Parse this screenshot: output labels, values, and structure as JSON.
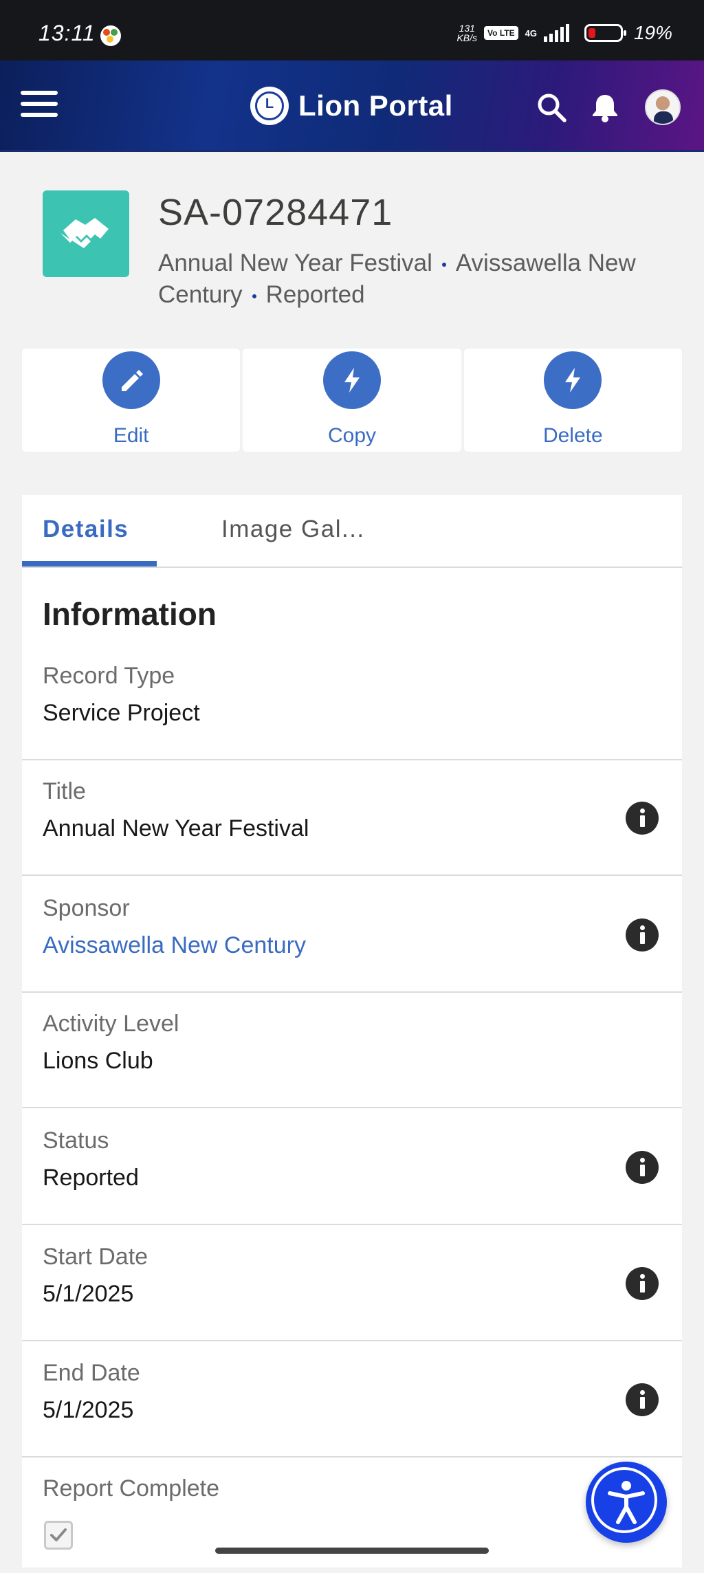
{
  "status_bar": {
    "time": "13:11",
    "net_speed_top": "131",
    "net_speed_bottom": "KB/s",
    "volte": "Vo LTE",
    "network": "4G",
    "battery": "19%"
  },
  "header": {
    "title": "Lion Portal",
    "menu_icon": "hamburger-menu-icon",
    "search_icon": "search-icon",
    "bell_icon": "notification-bell-icon",
    "avatar_icon": "user-avatar"
  },
  "record": {
    "id": "SA-07284471",
    "icon": "handshake-icon",
    "icon_color": "#3cc3b2",
    "subtitle": {
      "title": "Annual New Year Festival",
      "sponsor": "Avissawella New Century",
      "status": "Reported"
    }
  },
  "actions": [
    {
      "label": "Edit",
      "icon": "pencil-icon"
    },
    {
      "label": "Copy",
      "icon": "lightning-icon"
    },
    {
      "label": "Delete",
      "icon": "lightning-icon"
    }
  ],
  "tabs": [
    {
      "label": "Details",
      "active": true
    },
    {
      "label": "Image Gal..."
    }
  ],
  "section": {
    "title": "Information"
  },
  "fields": [
    {
      "label": "Record Type",
      "value": "Service Project",
      "info": false
    },
    {
      "label": "Title",
      "value": "Annual New Year Festival",
      "info": true
    },
    {
      "label": "Sponsor",
      "value": "Avissawella New Century",
      "info": true,
      "link": true
    },
    {
      "label": "Activity Level",
      "value": "Lions Club",
      "info": false
    },
    {
      "label": "Status",
      "value": "Reported",
      "info": true
    },
    {
      "label": "Start Date",
      "value": "5/1/2025",
      "info": true
    },
    {
      "label": "End Date",
      "value": "5/1/2025",
      "info": true
    },
    {
      "label": "Report Complete",
      "value": "",
      "info": false,
      "checked": true
    }
  ],
  "accessibility_button": {
    "icon": "accessibility-icon"
  },
  "colors": {
    "accent": "#3a6bc2",
    "action_circle": "#3d6ec5",
    "header_start": "#0c1f5b",
    "header_end": "#5b1585",
    "fab": "#1740e6"
  }
}
